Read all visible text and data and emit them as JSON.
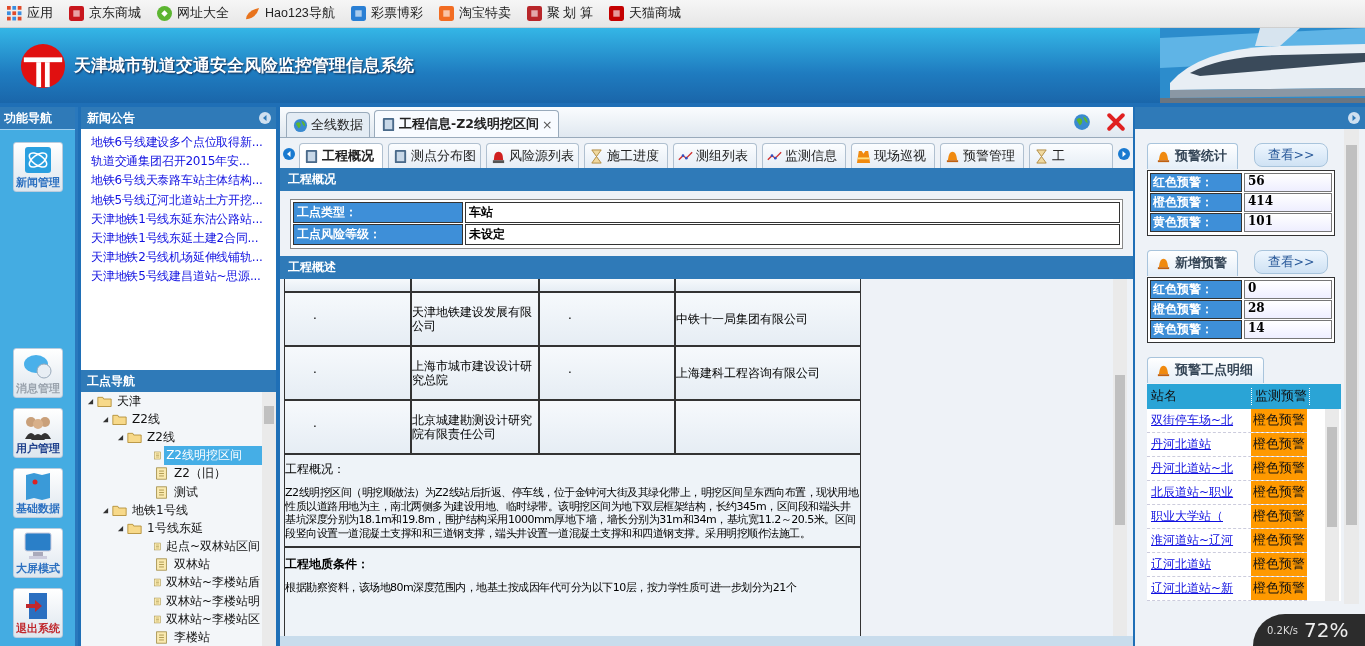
{
  "bookmarks": [
    {
      "label": "应用",
      "kind": "grid",
      "color": "#e04a2a"
    },
    {
      "label": "京东商城",
      "kind": "tile",
      "color": "#c8161d"
    },
    {
      "label": "网址大全",
      "kind": "circle",
      "color": "#5cb531"
    },
    {
      "label": "Hao123导航",
      "kind": "leaf",
      "color": "#e8731c"
    },
    {
      "label": "彩票博彩",
      "kind": "tile",
      "color": "#2a7fd4"
    },
    {
      "label": "淘宝特卖",
      "kind": "tile",
      "color": "#f26c22"
    },
    {
      "label": "聚 划 算",
      "kind": "tile",
      "color": "#b8262a"
    },
    {
      "label": "天猫商城",
      "kind": "tile",
      "color": "#c40000"
    }
  ],
  "header": {
    "title": "天津城市轨道交通安全风险监控管理信息系统"
  },
  "nav": {
    "title": "功能导航",
    "items": [
      {
        "label": "新闻管理",
        "kind": "globe",
        "color": "#2a6fc0"
      },
      {
        "label": "消息管理",
        "kind": "chat",
        "color": "#9aa3ad"
      },
      {
        "label": "用户管理",
        "kind": "users",
        "color": "#1d3f8c"
      },
      {
        "label": "基础数据",
        "kind": "map",
        "color": "#2a6fc0"
      },
      {
        "label": "大屏模式",
        "kind": "monitor",
        "color": "#2a6fc0"
      },
      {
        "label": "退出系统",
        "kind": "exit",
        "color": "#c0282d"
      }
    ]
  },
  "news": {
    "title": "新闻公告",
    "items": [
      "地铁6号线建设多个点位取得新...",
      "轨道交通集团召开2015年安...",
      "地铁6号线天泰路车站主体结构...",
      "地铁5号线辽河北道站土方开挖...",
      "天津地铁1号线东延东沽公路站...",
      "天津地铁1号线东延土建2合同...",
      "天津地铁2号线机场延伸线铺轨...",
      "天津地铁5号线建昌道站~思源..."
    ]
  },
  "site_nav": {
    "title": "工点导航",
    "tree": [
      {
        "label": "天津",
        "kind": "folder",
        "expanded": true,
        "selected": false,
        "children": [
          {
            "label": "Z2线",
            "kind": "folder",
            "expanded": true,
            "selected": false,
            "children": [
              {
                "label": "Z2线",
                "kind": "folder",
                "expanded": true,
                "selected": false,
                "children": [
                  {
                    "label": "Z2线明挖区间",
                    "kind": "file",
                    "selected": true
                  },
                  {
                    "label": "Z2（旧）",
                    "kind": "file",
                    "selected": false
                  },
                  {
                    "label": "测试",
                    "kind": "file",
                    "selected": false
                  }
                ]
              }
            ]
          },
          {
            "label": "地铁1号线",
            "kind": "folder",
            "expanded": true,
            "selected": false,
            "children": [
              {
                "label": "1号线东延",
                "kind": "folder",
                "expanded": true,
                "selected": false,
                "children": [
                  {
                    "label": "起点~双林站区间",
                    "kind": "file",
                    "selected": false
                  },
                  {
                    "label": "双林站",
                    "kind": "file",
                    "selected": false
                  },
                  {
                    "label": "双林站~李楼站盾",
                    "kind": "file",
                    "selected": false
                  },
                  {
                    "label": "双林站~李楼站明",
                    "kind": "file",
                    "selected": false
                  },
                  {
                    "label": "双林站~李楼站区",
                    "kind": "file",
                    "selected": false
                  },
                  {
                    "label": "李楼站",
                    "kind": "file",
                    "selected": false
                  }
                ]
              }
            ]
          }
        ]
      }
    ]
  },
  "main_tabs": [
    {
      "label": "全线数据",
      "kind": "globe",
      "selected": false
    },
    {
      "label": "工程信息-Z2线明挖区间",
      "kind": "book",
      "selected": true,
      "close": "×"
    }
  ],
  "sub_tabs": [
    {
      "label": "工程概况",
      "kind": "book",
      "selected": true
    },
    {
      "label": "测点分布图",
      "kind": "book",
      "selected": false
    },
    {
      "label": "风险源列表",
      "kind": "alarm",
      "selected": false
    },
    {
      "label": "施工进度",
      "kind": "hourglass",
      "selected": false
    },
    {
      "label": "测组列表",
      "kind": "chart",
      "selected": false
    },
    {
      "label": "监测信息",
      "kind": "chart",
      "selected": false
    },
    {
      "label": "现场巡视",
      "kind": "vest",
      "selected": false
    },
    {
      "label": "预警管理",
      "kind": "bell",
      "selected": false
    },
    {
      "label": "工",
      "kind": "hourglass",
      "selected": false
    }
  ],
  "overview": {
    "title": "工程概况",
    "rows": [
      {
        "label": "工点类型：",
        "value": "车站"
      },
      {
        "label": "工点风险等级：",
        "value": "未设定"
      }
    ]
  },
  "description": {
    "title": "工程概述",
    "units": [
      {
        "cells": [
          "·",
          "天津地铁建设发展有限公司",
          "·",
          "中铁十一局集团有限公司"
        ]
      },
      {
        "cells": [
          "·",
          "上海市城市建设设计研究总院",
          "·",
          "上海建科工程咨询有限公司"
        ]
      },
      {
        "cells": [
          "·",
          "北京城建勘测设计研究院有限责任公司"
        ]
      }
    ],
    "sections": [
      {
        "kind": "plain",
        "title": "工程概况：",
        "body": "Z2线明挖区间（明挖顺做法）为Z2线站后折返、停车线，位于金钟河大街及其绿化带上，明挖区间呈东西向布置，现状用地性质以道路用地为主，南北两侧多为建设用地、临时绿带。该明挖区间为地下双层框架结构，长约345m，区间段和端头井基坑深度分别为18.1m和19.8m，围护结构采用1000mm厚地下墙，墙长分别为31m和34m，基坑宽11.2～20.5米。区间段竖向设置一道混凝土支撑和和三道钢支撑，端头井设置一道混凝土支撑和和四道钢支撑。采用明挖顺作法施工。"
      },
      {
        "kind": "strong",
        "title": "工程地质条件：",
        "body": "根据勘察资料，该场地80m深度范围内，地基土按成因年代可分为以下10层，按力学性质可进一步划分为21个"
      }
    ]
  },
  "alerts": {
    "groups": [
      {
        "title": "预警统计",
        "button": "查看>>",
        "rows": [
          {
            "label": "红色预警：",
            "value": "56"
          },
          {
            "label": "橙色预警：",
            "value": "414"
          },
          {
            "label": "黄色预警：",
            "value": "101"
          }
        ]
      },
      {
        "title": "新增预警",
        "button": "查看>>",
        "rows": [
          {
            "label": "红色预警：",
            "value": "0"
          },
          {
            "label": "橙色预警：",
            "value": "28"
          },
          {
            "label": "黄色预警：",
            "value": "14"
          }
        ]
      }
    ],
    "detail": {
      "title": "预警工点明细",
      "columns": [
        "站名",
        "监测预警"
      ],
      "rows": [
        {
          "name": "双街停车场~北",
          "alert": "橙色预警",
          "color": "#ff9900"
        },
        {
          "name": "丹河北道站",
          "alert": "橙色预警",
          "color": "#ff9900"
        },
        {
          "name": "丹河北道站~北",
          "alert": "橙色预警",
          "color": "#ff9900"
        },
        {
          "name": "北辰道站~职业",
          "alert": "橙色预警",
          "color": "#ff9900"
        },
        {
          "name": "职业大学站（",
          "alert": "橙色预警",
          "color": "#ff9900"
        },
        {
          "name": "淮河道站~辽河",
          "alert": "橙色预警",
          "color": "#ff9900"
        },
        {
          "name": "辽河北道站",
          "alert": "橙色预警",
          "color": "#ff9900"
        },
        {
          "name": "辽河北道站~新",
          "alert": "橙色预警",
          "color": "#ff9900"
        }
      ]
    }
  },
  "speed_widget": {
    "upload": "0.2K/s",
    "percent": "72%"
  }
}
